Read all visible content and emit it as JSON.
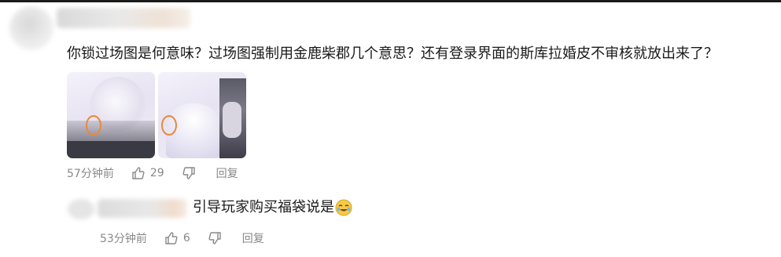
{
  "comment": {
    "text": "你锁过场图是何意味？过场图强制用金鹿柴郡几个意思？还有登录界面的斯库拉婚皮不审核就放出来了？",
    "images": [
      "screenshot-thumbnail-1",
      "screenshot-thumbnail-2"
    ],
    "time": "57分钟前",
    "likes": "29",
    "reply_label": "回复"
  },
  "reply": {
    "text": "引导玩家购买福袋说是",
    "emoji_icon": "teary-laugh-emoji",
    "time": "53分钟前",
    "likes": "6",
    "reply_label": "回复"
  },
  "icons": {
    "like": "thumbs-up-icon",
    "dislike": "thumbs-down-icon"
  },
  "colors": {
    "text": "#1a1a1a",
    "meta": "#888888",
    "highlight_circle": "#e8893a"
  }
}
